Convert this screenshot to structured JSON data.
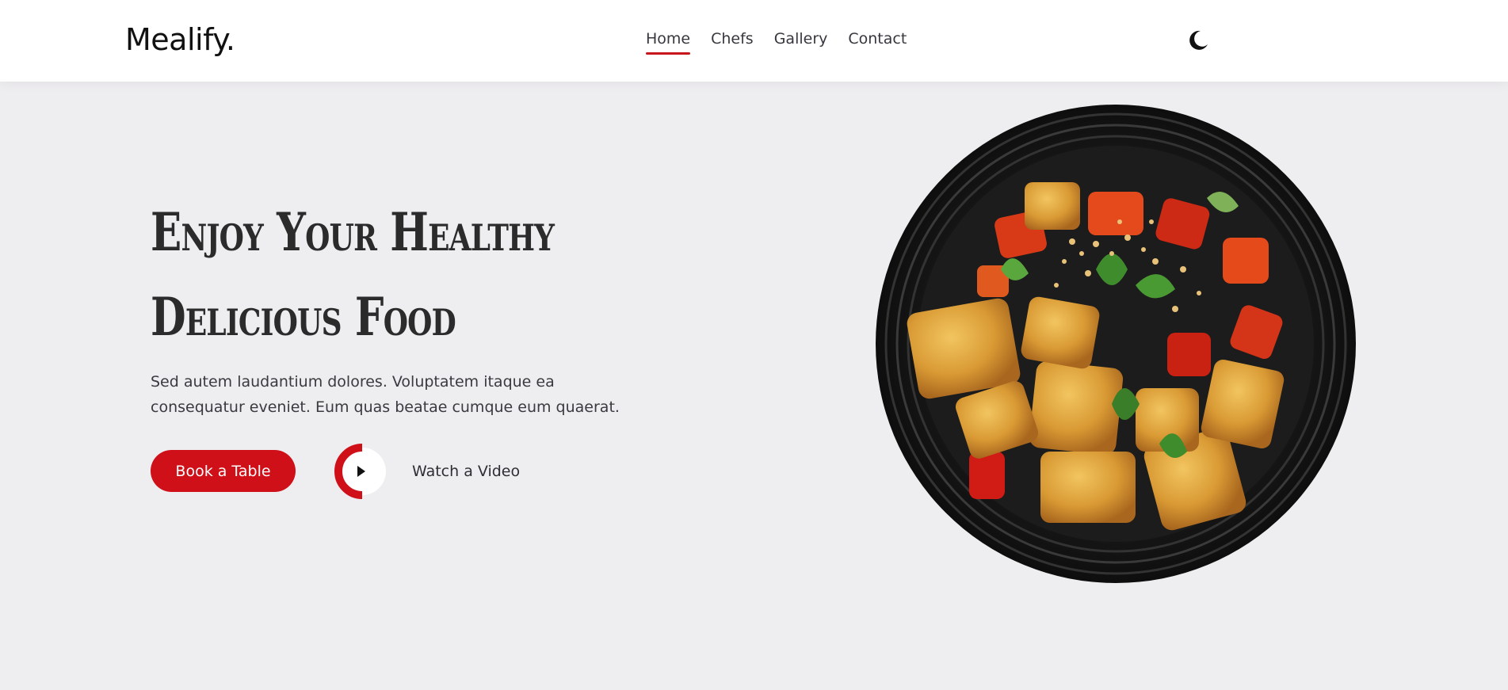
{
  "header": {
    "logo": "Mealify",
    "logo_dot": ".",
    "nav": [
      {
        "label": "Home",
        "active": true
      },
      {
        "label": "Chefs",
        "active": false
      },
      {
        "label": "Gallery",
        "active": false
      },
      {
        "label": "Contact",
        "active": false
      }
    ],
    "theme_icon": "moon-icon"
  },
  "hero": {
    "title_line1": "Enjoy Your Healthy",
    "title_line2": "Delicious Food",
    "description": "Sed autem laudantium dolores. Voluptatem itaque ea consequatur eveniet. Eum quas beatae cumque eum quaerat.",
    "book_label": "Book a Table",
    "video_label": "Watch a Video",
    "play_icon": "play-icon",
    "image": "food-plate-image"
  },
  "colors": {
    "accent": "#cf1018",
    "text": "#2b2b2b",
    "background": "#eeedf0",
    "header_bg": "#ffffff"
  }
}
